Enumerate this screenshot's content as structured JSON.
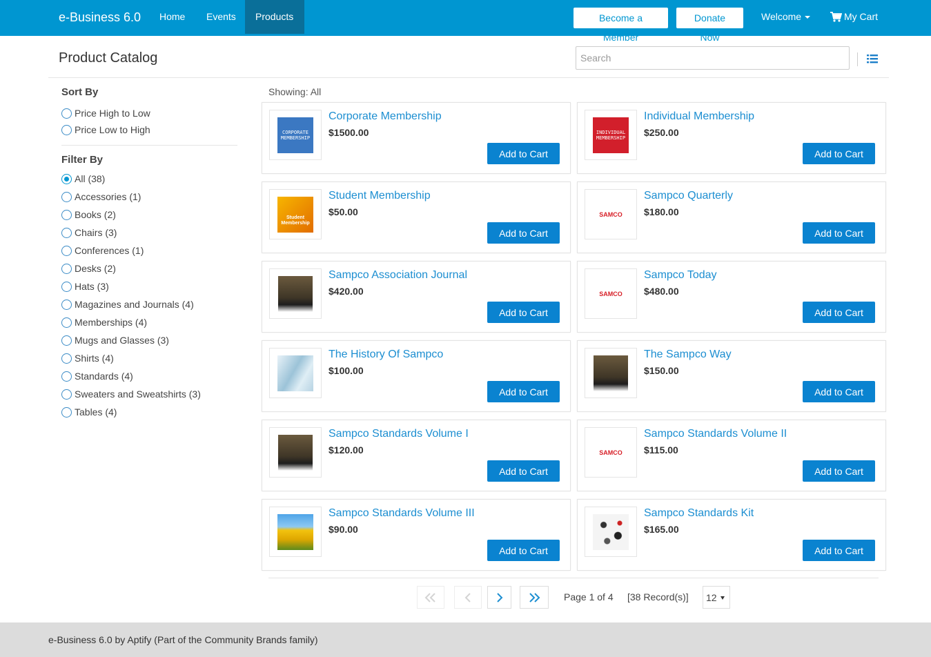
{
  "nav": {
    "brand": "e-Business 6.0",
    "links": [
      "Home",
      "Events",
      "Products"
    ],
    "active": "Products",
    "member_button": "Become a Member",
    "donate_button": "Donate Now",
    "welcome": "Welcome",
    "cart": "My Cart",
    "accent_color": "#0096d1"
  },
  "header": {
    "title": "Product Catalog",
    "search_placeholder": "Search",
    "view_icon": "list-view-icon"
  },
  "sidebar": {
    "sort_heading": "Sort By",
    "sort_options": [
      "Price High to Low",
      "Price Low to High"
    ],
    "filter_heading": "Filter By",
    "filters": [
      {
        "label": "All (38)",
        "selected": true
      },
      {
        "label": "Accessories (1)",
        "selected": false
      },
      {
        "label": "Books (2)",
        "selected": false
      },
      {
        "label": "Chairs (3)",
        "selected": false
      },
      {
        "label": "Conferences (1)",
        "selected": false
      },
      {
        "label": "Desks (2)",
        "selected": false
      },
      {
        "label": "Hats (3)",
        "selected": false
      },
      {
        "label": "Magazines and Journals (4)",
        "selected": false
      },
      {
        "label": "Memberships (4)",
        "selected": false
      },
      {
        "label": "Mugs and Glasses (3)",
        "selected": false
      },
      {
        "label": "Shirts (4)",
        "selected": false
      },
      {
        "label": "Standards (4)",
        "selected": false
      },
      {
        "label": "Sweaters and Sweatshirts (3)",
        "selected": false
      },
      {
        "label": "Tables (4)",
        "selected": false
      }
    ]
  },
  "catalog": {
    "showing": "Showing: All",
    "add_label": "Add to Cart",
    "products": [
      {
        "name": "Corporate Membership",
        "price": "$1500.00",
        "thumb": "corporate-membership",
        "thumb_text": "CORPORATE MEMBERSHIP"
      },
      {
        "name": "Individual Membership",
        "price": "$250.00",
        "thumb": "individual-membership",
        "thumb_text": "INDIVIDUAL MEMBERSHIP"
      },
      {
        "name": "Student Membership",
        "price": "$50.00",
        "thumb": "student-membership",
        "thumb_text": "Student Membership"
      },
      {
        "name": "Sampco Quarterly",
        "price": "$180.00",
        "thumb": "samco-logo",
        "thumb_text": "SAMCO"
      },
      {
        "name": "Sampco Association Journal",
        "price": "$420.00",
        "thumb": "journal-cover",
        "thumb_text": ""
      },
      {
        "name": "Sampco Today",
        "price": "$480.00",
        "thumb": "samco-logo",
        "thumb_text": "SAMCO"
      },
      {
        "name": "The History Of Sampco",
        "price": "$100.00",
        "thumb": "glass-building",
        "thumb_text": ""
      },
      {
        "name": "The Sampco Way",
        "price": "$150.00",
        "thumb": "journal-cover",
        "thumb_text": ""
      },
      {
        "name": "Sampco Standards Volume I",
        "price": "$120.00",
        "thumb": "journal-cover",
        "thumb_text": ""
      },
      {
        "name": "Sampco Standards Volume II",
        "price": "$115.00",
        "thumb": "samco-logo",
        "thumb_text": "SAMCO"
      },
      {
        "name": "Sampco Standards Volume III",
        "price": "$90.00",
        "thumb": "tulips",
        "thumb_text": ""
      },
      {
        "name": "Sampco Standards Kit",
        "price": "$165.00",
        "thumb": "accessory-kit",
        "thumb_text": ""
      }
    ]
  },
  "pager": {
    "page_text": "Page 1 of 4",
    "records_text": "[38 Record(s)]",
    "page_size": "12"
  },
  "footer": {
    "text": "e-Business 6.0 by Aptify (Part of the Community Brands family)"
  }
}
